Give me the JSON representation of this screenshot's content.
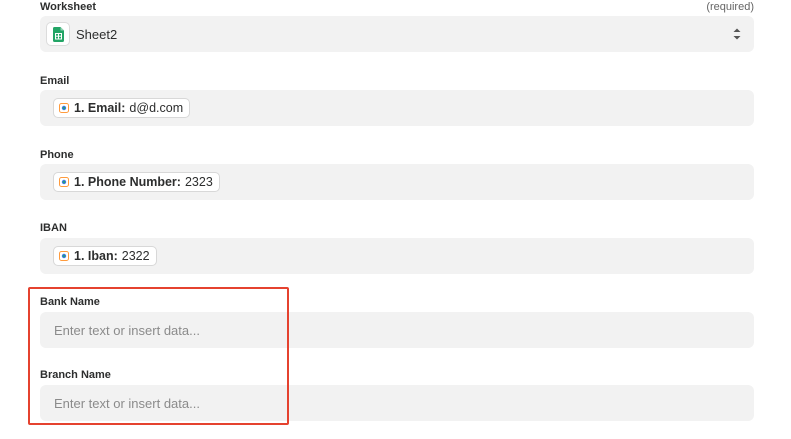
{
  "worksheet": {
    "label": "Worksheet",
    "required_text": "(required)",
    "value": "Sheet2",
    "app_icon": "google-sheets-icon",
    "control_icon": "up-down-chevron-icon"
  },
  "email": {
    "label": "Email",
    "pill_key": "1. Email:",
    "pill_value": "d@d.com"
  },
  "phone": {
    "label": "Phone",
    "pill_key": "1. Phone Number:",
    "pill_value": "2323"
  },
  "iban": {
    "label": "IBAN",
    "pill_key": "1. Iban:",
    "pill_value": "2322"
  },
  "bank_name": {
    "label": "Bank Name",
    "placeholder": "Enter text or insert data..."
  },
  "branch_name": {
    "label": "Branch Name",
    "placeholder": "Enter text or insert data..."
  },
  "colors": {
    "highlight": "#e5422f",
    "field_bg": "#f2f2f2",
    "sheets_green": "#23a566"
  },
  "pill_icon": "trigger-app-icon"
}
